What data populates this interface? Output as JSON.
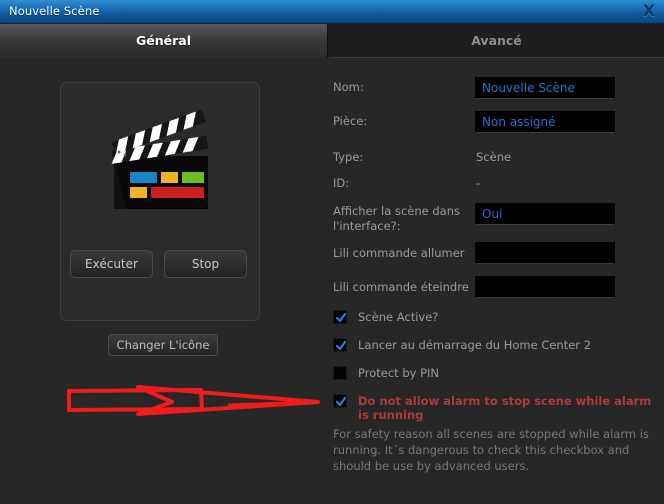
{
  "window": {
    "title": "Nouvelle Scène",
    "close_label": "X",
    "close_icon": "close-icon"
  },
  "tabs": [
    {
      "label": "Général",
      "active": true
    },
    {
      "label": "Avancé",
      "active": false
    }
  ],
  "left_panel": {
    "icon_name": "clapperboard-icon",
    "buttons": {
      "run": "Exécuter",
      "stop": "Stop",
      "change_icon": "Changer L'icône"
    },
    "annotation": {
      "name": "red-highlight-annotation",
      "color": "#ee1c1c",
      "shape": "rectangle-with-arrow"
    }
  },
  "form": {
    "fields": [
      {
        "label": "Nom:",
        "value": "Nouvelle Scène",
        "type": "input"
      },
      {
        "label": "Pièce:",
        "value": "Non assigné",
        "type": "select"
      },
      {
        "label": "Type:",
        "value": "Scène",
        "type": "static"
      },
      {
        "label": "ID:",
        "value": "-",
        "type": "static"
      },
      {
        "label": "Afficher la scène dans l'interface?:",
        "value": "Oui",
        "type": "select"
      },
      {
        "label": "Lili commande allumer",
        "value": "",
        "type": "input"
      },
      {
        "label": "Lili commande éteindre",
        "value": "",
        "type": "input"
      }
    ],
    "checkboxes": [
      {
        "label": "Scène Active?",
        "checked": true,
        "warning": false
      },
      {
        "label": "Lancer au démarrage du Home Center 2",
        "checked": true,
        "warning": false
      },
      {
        "label": "Protect by PIN",
        "checked": false,
        "warning": false
      },
      {
        "label": "Do not allow alarm to stop scene while alarm is running",
        "checked": true,
        "warning": true
      }
    ],
    "help_text": "For safety reason all scenes are stopped while alarm is running. It´s dangerous to check this checkbox and should be use by advanced users."
  },
  "colors": {
    "titlebar_blue": "#1f75bd",
    "input_text_blue": "#2f6fd0",
    "warning_red": "#b03a3a",
    "annotation_red": "#ee1c1c",
    "background": "#272727"
  }
}
